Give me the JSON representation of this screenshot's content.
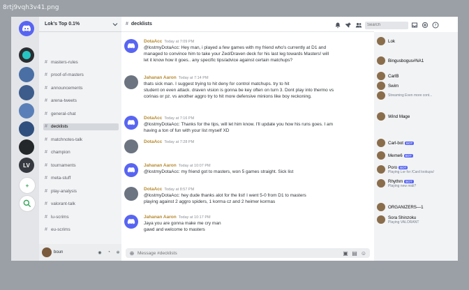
{
  "window": {
    "file_label": "8rtj9vqh3v41.png"
  },
  "rail": {
    "guilds": [
      {
        "name": "home",
        "label": ""
      },
      {
        "name": "gamer-dog",
        "label": ""
      },
      {
        "name": "server-blue-1",
        "label": ""
      },
      {
        "name": "server-blue-2",
        "label": ""
      },
      {
        "name": "server-blue-3",
        "label": ""
      },
      {
        "name": "server-blue-4",
        "label": ""
      },
      {
        "name": "server-dark",
        "label": ""
      },
      {
        "name": "server-lv",
        "label": "LV"
      },
      {
        "name": "add-server",
        "label": "+"
      },
      {
        "name": "explore",
        "label": ""
      }
    ]
  },
  "server": {
    "name": "Lok's Top 0.1%"
  },
  "channels": [
    {
      "label": "masters-rules",
      "selected": false
    },
    {
      "label": "proof-of-masters",
      "selected": false
    },
    {
      "label": "announcements",
      "selected": false
    },
    {
      "label": "arena-tweets",
      "selected": false
    },
    {
      "label": "general-chat",
      "selected": false
    },
    {
      "label": "decklists",
      "selected": true
    },
    {
      "label": "matchnotes-talk",
      "selected": false
    },
    {
      "label": "champion",
      "selected": false
    },
    {
      "label": "tournaments",
      "selected": false
    },
    {
      "label": "meta-stuff",
      "selected": false
    },
    {
      "label": "play-analysis",
      "selected": false
    },
    {
      "label": "valorant-talk",
      "selected": false
    },
    {
      "label": "lu-scrims",
      "selected": false
    },
    {
      "label": "eu-scrims",
      "selected": false
    }
  ],
  "user_panel": {
    "name": "boun"
  },
  "chat": {
    "channel_name": "decklists",
    "composer_placeholder": "Message #decklists"
  },
  "messages": [
    {
      "kind": "bot",
      "name": "DotaAcc",
      "time": "Today at 7:09 PM",
      "lines": [
        "@lostmyDotaAcc: Hey man, i played a few games with my friend who's currently at D1 and",
        "managed to convince him to take your Zed/Draven deck for his last leg towards Masters! will",
        "let it know how it goes.. any specific tips/advice against certain matchups?"
      ]
    },
    {
      "kind": "user",
      "name": "Jahanan Aaron",
      "time": "Today at 7:14 PM",
      "lines": [
        "thats sick man. I suggest trying to hit deny for control matchups. try to hit",
        "student on even attack. draven vision is gonna be key often on turn 3. Dont play into thermo vs",
        "corinas or pz. vs another aggro try to hit more defensive minions like boy reckoning."
      ]
    },
    {
      "kind": "bot",
      "name": "DotaAcc",
      "time": "Today at 7:16 PM",
      "lines": [
        "@lostmyDotaAcc: Thanks for the tips, will let him know. I'll update you how his runs goes. I am",
        "having a ton of fun with your list myself XD"
      ]
    },
    {
      "kind": "user",
      "name": "DotaAcc",
      "time": "Today at 7:28 PM",
      "lines": []
    },
    {
      "kind": "bot",
      "name": "Jahanan Aaron",
      "time": "Today at 10:07 PM",
      "lines": [
        "@lostmyDotaAcc: my friend got to masters, won 5 games straight. Sick list"
      ]
    },
    {
      "kind": "user",
      "name": "DotaAcc",
      "time": "Today at 8:57 PM",
      "lines": [
        "@lostmyDotaAcc: hey dude thanks alot for the list! I went 5-0 from D1 to masters",
        "playing against 2 aggro spiders, 1 korma cz and 2 heimer kormas"
      ]
    },
    {
      "kind": "bot",
      "name": "Jahanan Aaron",
      "time": "Today at 10:17 PM",
      "lines": [
        "Jaya  you are gonna make me cry man",
        "gawd and welcome to masters"
      ]
    }
  ],
  "toolbar": {
    "search_placeholder": "Search",
    "buttons": [
      "bell-icon",
      "pin-icon",
      "members-icon"
    ]
  },
  "members": [
    {
      "name": "Lok",
      "sub": "",
      "badge": ""
    },
    {
      "name": "Bingusbogus#NA1",
      "sub": "",
      "badge": ""
    },
    {
      "name": "CarlB",
      "sub": "",
      "badge": ""
    },
    {
      "name": "Swim",
      "sub": "",
      "badge": ""
    },
    {
      "name": "",
      "sub": "Streaming Even more cont...",
      "badge": ""
    },
    {
      "name": "Wind Mage",
      "sub": "",
      "badge": ""
    },
    {
      "name": "Carl-bot",
      "sub": "",
      "badge": "BOT"
    },
    {
      "name": "Meme6",
      "sub": "",
      "badge": "BOT"
    },
    {
      "name": "Poro",
      "sub": "Playing Lor for /Card lookups/",
      "badge": "BOT"
    },
    {
      "name": "Rhythm",
      "sub": "Playing new midi?",
      "badge": "BOT"
    },
    {
      "name": "ORGANIZERS—1",
      "sub": "",
      "badge": ""
    },
    {
      "name": "Sora Shinzoku",
      "sub": "Playing VALORANT",
      "badge": ""
    }
  ]
}
